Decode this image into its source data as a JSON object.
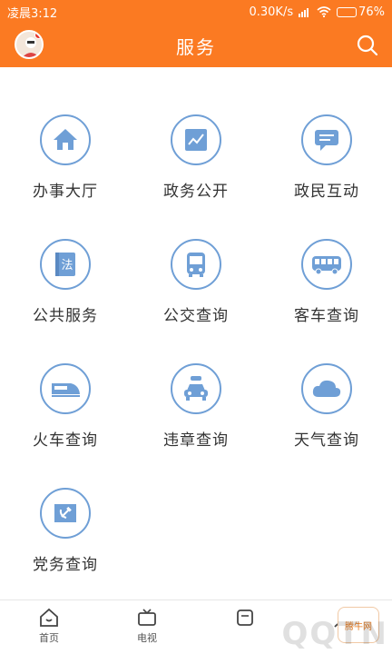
{
  "status_bar": {
    "time": "凌晨3:12",
    "speed": "0.30K/s",
    "battery": "76%",
    "battery_level": 0.76
  },
  "header": {
    "title": "服务"
  },
  "services": [
    {
      "label": "办事大厅",
      "icon": "house-icon"
    },
    {
      "label": "政务公开",
      "icon": "chart-icon"
    },
    {
      "label": "政民互动",
      "icon": "chat-icon"
    },
    {
      "label": "公共服务",
      "icon": "law-book-icon"
    },
    {
      "label": "公交查询",
      "icon": "bus-front-icon"
    },
    {
      "label": "客车查询",
      "icon": "coach-icon"
    },
    {
      "label": "火车查询",
      "icon": "train-icon"
    },
    {
      "label": "违章查询",
      "icon": "car-icon"
    },
    {
      "label": "天气查询",
      "icon": "cloud-icon"
    },
    {
      "label": "党务查询",
      "icon": "party-flag-icon"
    }
  ],
  "tabbar": [
    {
      "label": "首页",
      "icon": "home-icon"
    },
    {
      "label": "电视",
      "icon": "tv-icon"
    },
    {
      "label": "",
      "icon": "service-icon"
    },
    {
      "label": "",
      "icon": "user-icon"
    }
  ],
  "watermark": {
    "text": "QQTN",
    "badge": "腾牛网"
  },
  "colors": {
    "brand_orange": "#fb7a22",
    "icon_blue": "#6f9fd6"
  }
}
